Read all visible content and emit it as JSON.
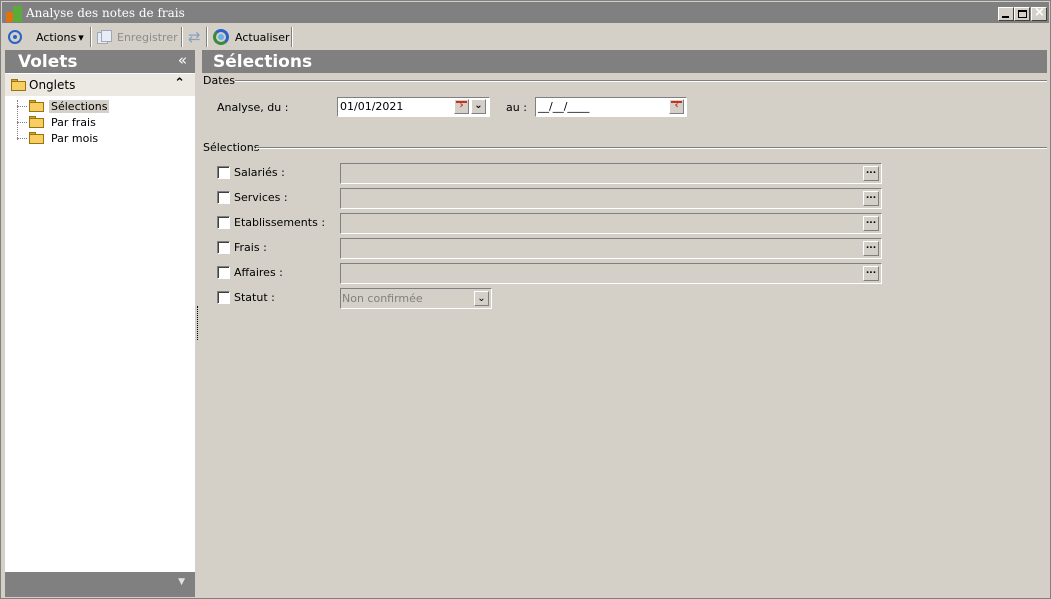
{
  "window": {
    "title": "Analyse des notes de frais",
    "controls": {
      "minimize_icon": "minimize-icon",
      "maximize_icon": "maximize-icon",
      "close_icon": "close-icon"
    }
  },
  "toolbar": {
    "actions_label": "Actions",
    "actions_arrow": "▾",
    "save_label": "Enregistrer",
    "refresh_label": "Actualiser"
  },
  "left_panel": {
    "title": "Volets",
    "collapse_glyph": "«",
    "section_title": "Onglets",
    "section_glyph": "⌃",
    "tree": [
      {
        "label": "Sélections",
        "selected": true
      },
      {
        "label": "Par frais",
        "selected": false
      },
      {
        "label": "Par mois",
        "selected": false
      }
    ],
    "footer_glyph": "▼"
  },
  "main": {
    "title": "Sélections",
    "dates_group": {
      "title": "Dates",
      "from_label": "Analyse, du :",
      "from_value": "01/01/2021",
      "to_label": "au :",
      "to_value": "__/__/____"
    },
    "selections_group": {
      "title": "Sélections",
      "rows": [
        {
          "label": "Salariés :",
          "checked": false,
          "value": ""
        },
        {
          "label": "Services :",
          "checked": false,
          "value": ""
        },
        {
          "label": "Etablissements :",
          "checked": false,
          "value": ""
        },
        {
          "label": "Frais :",
          "checked": false,
          "value": ""
        },
        {
          "label": "Affaires :",
          "checked": false,
          "value": ""
        }
      ],
      "status": {
        "label": "Statut :",
        "checked": false,
        "selected": "Non confirmée"
      },
      "ellipsis": "..."
    }
  }
}
